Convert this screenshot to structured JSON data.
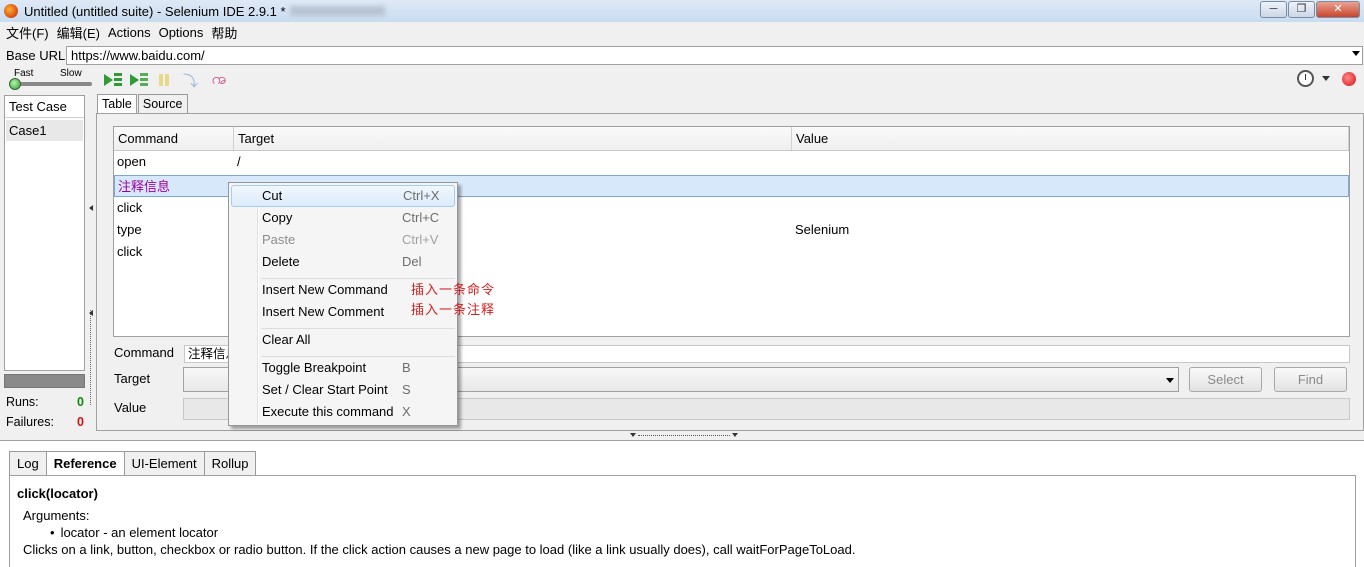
{
  "window": {
    "title": "Untitled (untitled suite) - Selenium IDE 2.9.1 *",
    "buttons": [
      "─",
      "❐",
      "✕"
    ]
  },
  "menu": [
    "文件(F)",
    "编辑(E)",
    "Actions",
    "Options",
    "帮助"
  ],
  "base_url": {
    "label": "Base URL",
    "value": "https://www.baidu.com/"
  },
  "toolbar": {
    "fast": "Fast",
    "slow": "Slow",
    "speed_level": 0.0
  },
  "test_cases": {
    "header": "Test Case",
    "items": [
      "Case1"
    ]
  },
  "stats": {
    "runs_label": "Runs:",
    "runs": "0",
    "failures_label": "Failures:",
    "failures": "0"
  },
  "editor_tabs": [
    "Table",
    "Source"
  ],
  "table": {
    "headers": [
      "Command",
      "Target",
      "Value"
    ],
    "rows": [
      {
        "command": "open",
        "target": "/",
        "value": ""
      },
      {
        "command": "注释信息",
        "target": "",
        "value": ""
      },
      {
        "command": "click",
        "target": "",
        "value": ""
      },
      {
        "command": "type",
        "target": "",
        "value": "Selenium"
      },
      {
        "command": "click",
        "target": "",
        "value": ""
      }
    ]
  },
  "form": {
    "command_label": "Command",
    "command_value": "注释信息",
    "target_label": "Target",
    "value_label": "Value",
    "select_button": "Select",
    "find_button": "Find"
  },
  "context_menu": {
    "items": [
      {
        "label": "Cut",
        "shortcut": "Ctrl+X"
      },
      {
        "label": "Copy",
        "shortcut": "Ctrl+C"
      },
      {
        "label": "Paste",
        "shortcut": "Ctrl+V"
      },
      {
        "label": "Delete",
        "shortcut": "Del"
      },
      {
        "label": "Insert New Command",
        "shortcut": ""
      },
      {
        "label": "Insert New Comment",
        "shortcut": ""
      },
      {
        "label": "Clear All",
        "shortcut": ""
      },
      {
        "label": "Toggle Breakpoint",
        "shortcut": "B"
      },
      {
        "label": "Set / Clear Start Point",
        "shortcut": "S"
      },
      {
        "label": "Execute this command",
        "shortcut": "X"
      }
    ],
    "annotations": [
      "插入一条命令",
      "插入一条注释"
    ]
  },
  "bottom_tabs": [
    "Log",
    "Reference",
    "UI-Element",
    "Rollup"
  ],
  "reference": {
    "title": "click(locator)",
    "arguments_label": "Arguments:",
    "argument": "locator - an element locator",
    "description": "Clicks on a link, button, checkbox or radio button. If the click action causes a new page to load (like a link usually does), call waitForPageToLoad."
  },
  "colors": {
    "comment": "#a000a0",
    "selection": "#d7e8fa",
    "annotation": "#d42020"
  }
}
